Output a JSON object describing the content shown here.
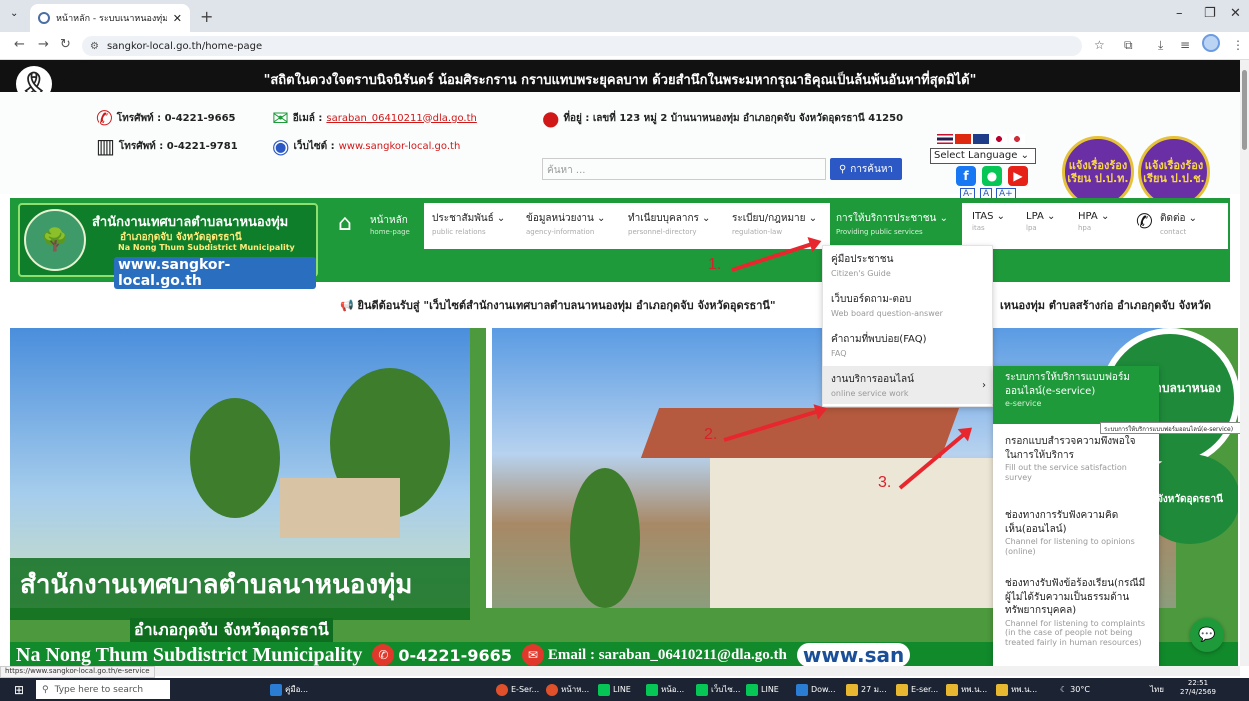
{
  "browser": {
    "tab_title": "หน้าหลัก - ระบบเนาหนองทุ่ม อ.กุดจับ",
    "tab_close": "✕",
    "new_tab": "+",
    "url": "sangkor-local.go.th/home-page",
    "status_url": "https://www.sangkor-local.go.th/e-service"
  },
  "mourning": {
    "text": "\"สถิตในดวงใจตราบนิจนิรันดร์ น้อมศิระกราน กราบแทบพระยุคลบาท ด้วยสำนึกในพระมหากรุณาธิคุณเป็นล้นพ้นอันหาที่สุดมิได้\""
  },
  "contact": {
    "phone1": "โทรศัพท์ : 0-4221-9665",
    "phone2": "โทรศัพท์ : 0-4221-9781",
    "email_label": "อีเมล์ :",
    "email": "saraban_06410211@dla.go.th",
    "website_label": "เว็บไซต์ :",
    "website": "www.sangkor-local.go.th",
    "address": "ที่อยู่ : เลขที่ 123 หมู่ 2 บ้านนาหนองทุ่ม อำเภอกุดจับ จังหวัดอุดรธานี 41250",
    "search_placeholder": "ค้นหา ...",
    "search_button": "การค้นหา",
    "language": "Select Language",
    "font_small": "A-",
    "font_normal": "A",
    "font_large": "A+",
    "badge1": "แจ้งเรื่องร้องเรียน ป.ป.ท.",
    "badge2": "แจ้งเรื่องร้องเรียน ป.ป.ช."
  },
  "logo": {
    "title": "สำนักงานเทศบาลตำบลนาหนองทุ่ม",
    "subtitle": "อำเภอกุดจับ จังหวัดอุดรธานี",
    "english": "Na Nong Thum Subdistrict Municipality",
    "url": "www.sangkor-local.go.th"
  },
  "menu": {
    "home": {
      "label": "หน้าหลัก",
      "sub": "home-page"
    },
    "items": [
      {
        "label": "ประชาสัมพันธ์",
        "sub": "public relations"
      },
      {
        "label": "ข้อมูลหน่วยงาน",
        "sub": "agency-information"
      },
      {
        "label": "ทำเนียบบุคลากร",
        "sub": "personnel-directory"
      },
      {
        "label": "ระเบียบ/กฎหมาย",
        "sub": "regulation-law"
      },
      {
        "label": "การให้บริการประชาชน",
        "sub": "Providing public services"
      },
      {
        "label": "ITAS",
        "sub": "itas"
      },
      {
        "label": "LPA",
        "sub": "lpa"
      },
      {
        "label": "HPA",
        "sub": "hpa"
      },
      {
        "label": "ติดต่อ",
        "sub": "contact"
      }
    ]
  },
  "marquee": {
    "text": "ยินดีต้อนรับสู่ \"เว็บไซต์สำนักงานเทศบาลตำบลนาหนองทุ่ม อำเภอกุดจับ จังหวัดอุดรธานี\"",
    "text2": "เหนองทุ่ม ตำบลสร้างก่อ อำเภอกุดจับ จังหวัด"
  },
  "dropdown": [
    {
      "label": "คู่มือประชาชน",
      "sub": "Citizen's Guide"
    },
    {
      "label": "เว็บบอร์ดถาม-ตอบ",
      "sub": "Web board question-answer"
    },
    {
      "label": "คำถามที่พบบ่อย(FAQ)",
      "sub": "FAQ"
    },
    {
      "label": "งานบริการออนไลน์",
      "sub": "online service work"
    }
  ],
  "submenu": [
    {
      "label": "ระบบการให้บริการแบบฟอร์มออนไลน์(e-service)",
      "sub": "e-service"
    },
    {
      "label": "กรอกแบบสำรวจความพึงพอใจในการให้บริการ",
      "sub": "Fill out the service satisfaction survey"
    },
    {
      "label": "ช่องทางการรับฟังความคิดเห็น(ออนไลน์)",
      "sub": "Channel for listening to opinions (online)"
    },
    {
      "label": "ช่องทางรับฟังข้อร้องเรียน(กรณีมีผู้ไม่ได้รับความเป็นธรรมด้านทรัพยากรบุคคล)",
      "sub": "Channel for listening to complaints (in the case of people not being treated fairly in human resources)"
    }
  ],
  "tooltip": "ระบบการให้บริการแบบฟอร์มออนไลน์(e-service)",
  "annotations": [
    "1.",
    "2.",
    "3."
  ],
  "banner": {
    "big": "สำนักงานเทศบาลตำบลนาหนองทุ่ม",
    "sub": "อำเภอกุดจับ จังหวัดอุดรธานี",
    "english": "Na Nong Thum Subdistrict Municipality",
    "phone": "0-4221-9665",
    "email": "Email : saraban_06410211@dla.go.th",
    "web": "www.san",
    "seal1": "เทศบาลตำบลนาหนองทุ่ม",
    "seal2": "จังหวัดอุดรธานี"
  },
  "taskbar": {
    "search": "Type here to search",
    "items": [
      "คู่มือ...",
      "E-Ser...",
      "หน้าห...",
      "LINE",
      "หน้อ...",
      "เว็บไซ...",
      "LINE",
      "Dow...",
      "27 ม...",
      "E-ser...",
      "หพ.น...",
      "หพ.น..."
    ],
    "weather": "30°C",
    "lang": "ไทย",
    "time": "22:51",
    "date": "27/4/2569"
  },
  "colors": {
    "primary_green": "#1e9a3a",
    "accent_red": "#e8262d",
    "link_blue": "#2b58c4"
  }
}
